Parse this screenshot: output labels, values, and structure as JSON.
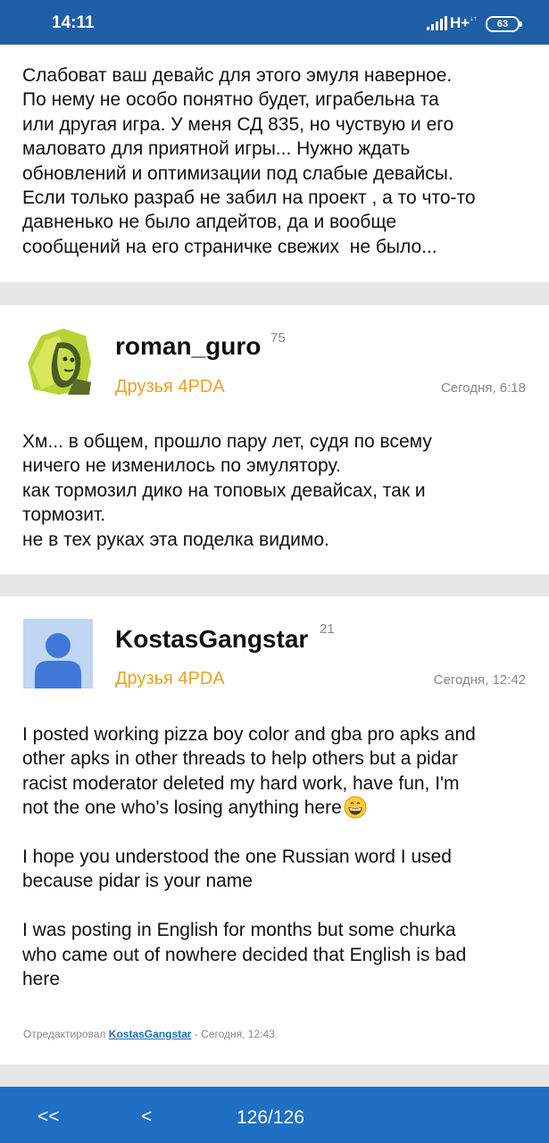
{
  "status_bar": {
    "time": "14:11",
    "network": "H+",
    "network_sub": "↓↑",
    "battery": "63"
  },
  "posts": [
    {
      "body": "Слабоват ваш девайс для этого эмуля наверное.\nПо нему не особо понятно будет, играбельна та\nили другая игра. У меня СД 835, но чуствую и его\nмаловато для приятной игры... Нужно ждать\nобновлений и оптимизации под слабые девайсы.\nЕсли только разраб не забил на проект , а то что-то\nдавненько не было апдейтов, да и вообще\nсообщений на его страничке свежих  не было..."
    },
    {
      "username": "roman_guro",
      "reputation": "75",
      "group": "Друзья 4PDA",
      "date": "Сегодня, 6:18",
      "body": "Хм... в общем, прошло пару лет, судя по всему\nничего не изменилось по эмулятору.\nкак тормозил дико на топовых девайсах, так и\nтормозит.\nне в тех руках эта поделка видимо."
    },
    {
      "username": "KostasGangstar",
      "reputation": "21",
      "group": "Друзья 4PDA",
      "date": "Сегодня, 12:42",
      "body": "I posted working pizza boy color and gba pro apks and\nother apks in other threads to help others but a pidar\nracist moderator deleted my hard work, have fun, I'm\nnot the one who's losing anything here",
      "body2": "I hope you understood the one Russian word I used\nbecause pidar is your name\n\nI was posting in English for months but some churka\nwho came out of nowhere decided that English is bad\nhere",
      "emoji": "grinning-face-icon",
      "edited_prefix": "Отредактировал ",
      "edited_by": "KostasGangstar",
      "edited_suffix": " - Сегодня, 12:43"
    }
  ],
  "pagination": {
    "first_label": "<<",
    "prev_label": "<",
    "page_indicator": "126/126"
  },
  "colors": {
    "status_bar": "#1f5fa5",
    "bottom_bar": "#1f6fc5",
    "group": "#f0a020",
    "link": "#1f6fb5"
  }
}
